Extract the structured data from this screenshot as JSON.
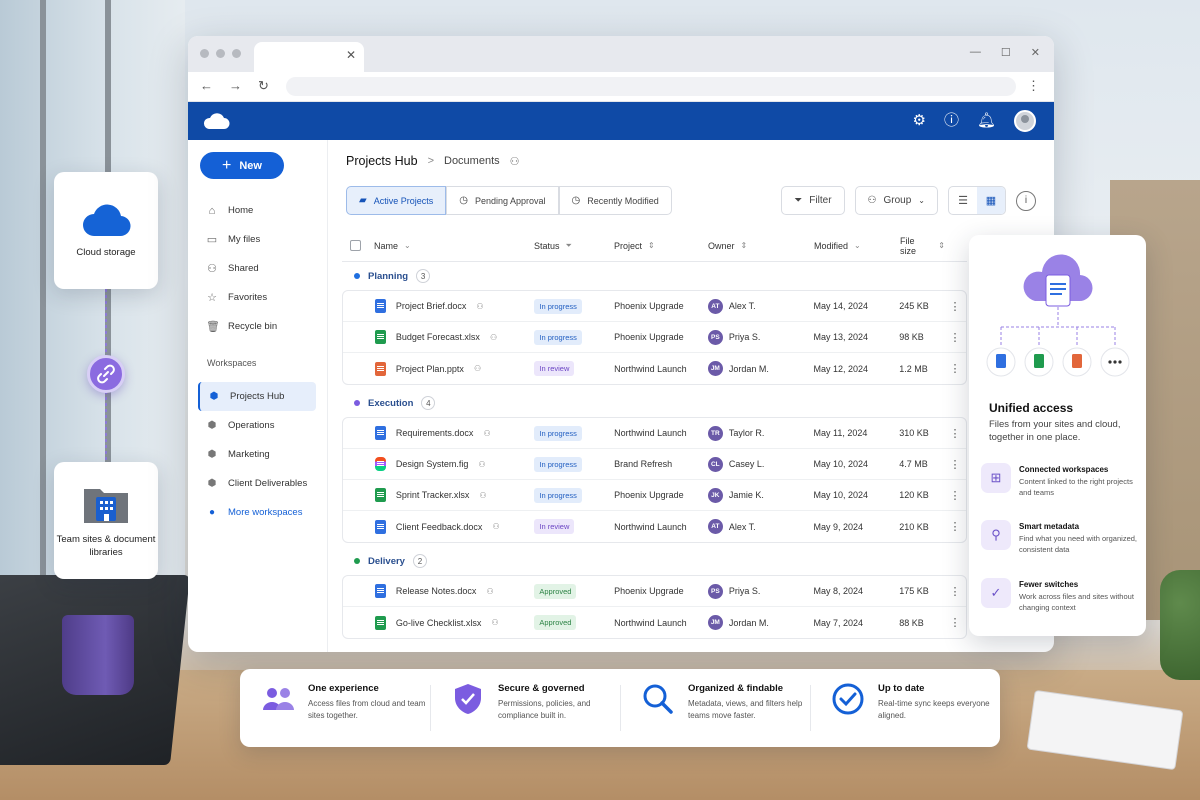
{
  "colors": {
    "brand_blue": "#0f4aa6",
    "accent_blue": "#1460d6",
    "accent_purple": "#7b5ce0",
    "status_progress": "#2460c2",
    "status_review": "#6b45c4",
    "status_approved": "#2d8446"
  },
  "floating": {
    "cloud_label": "Cloud storage",
    "team_label": "Team sites & document libraries"
  },
  "sidebar": {
    "new_label": "New",
    "items": [
      {
        "label": "Home",
        "icon": "home-icon"
      },
      {
        "label": "My files",
        "icon": "folder-icon"
      },
      {
        "label": "Shared",
        "icon": "people-icon"
      },
      {
        "label": "Favorites",
        "icon": "star-icon"
      },
      {
        "label": "Recycle bin",
        "icon": "trash-icon"
      }
    ],
    "workspaces_title": "Workspaces",
    "workspaces": [
      {
        "label": "Projects Hub",
        "active": true
      },
      {
        "label": "Operations"
      },
      {
        "label": "Marketing"
      },
      {
        "label": "Client Deliverables"
      }
    ],
    "more_label": "More workspaces"
  },
  "breadcrumb": {
    "hub": "Projects Hub",
    "separator": ">",
    "current": "Documents"
  },
  "views": {
    "tabs": [
      {
        "label": "Active Projects",
        "icon": "folder-icon",
        "active": true
      },
      {
        "label": "Pending Approval",
        "icon": "clock-icon"
      },
      {
        "label": "Recently Modified",
        "icon": "clock-icon"
      }
    ]
  },
  "toolbar": {
    "filter_label": "Filter",
    "group_label": "Group"
  },
  "table": {
    "columns": {
      "name": "Name",
      "status": "Status",
      "project": "Project",
      "owner": "Owner",
      "modified": "Modified",
      "size": "File size"
    },
    "groups": [
      {
        "name": "Planning",
        "count": "3",
        "color": "#1f6fe0",
        "rows": [
          {
            "file": "Project Brief.docx",
            "type": "doc",
            "status": "In progress",
            "status_kind": "progress",
            "project": "Phoenix Upgrade",
            "initials": "AT",
            "owner": "Alex T.",
            "modified": "May 14, 2024",
            "size": "245 KB"
          },
          {
            "file": "Budget Forecast.xlsx",
            "type": "xls",
            "status": "In progress",
            "status_kind": "progress",
            "project": "Phoenix Upgrade",
            "initials": "PS",
            "owner": "Priya S.",
            "modified": "May 13, 2024",
            "size": "98 KB"
          },
          {
            "file": "Project Plan.pptx",
            "type": "ppt",
            "status": "In review",
            "status_kind": "review",
            "project": "Northwind Launch",
            "initials": "JM",
            "owner": "Jordan M.",
            "modified": "May 12, 2024",
            "size": "1.2 MB"
          }
        ]
      },
      {
        "name": "Execution",
        "count": "4",
        "color": "#7b5ce0",
        "rows": [
          {
            "file": "Requirements.docx",
            "type": "doc",
            "status": "In progress",
            "status_kind": "progress",
            "project": "Northwind Launch",
            "initials": "TR",
            "owner": "Taylor R.",
            "modified": "May 11, 2024",
            "size": "310 KB"
          },
          {
            "file": "Design System.fig",
            "type": "fig",
            "status": "In progress",
            "status_kind": "progress",
            "project": "Brand Refresh",
            "initials": "CL",
            "owner": "Casey L.",
            "modified": "May 10, 2024",
            "size": "4.7 MB"
          },
          {
            "file": "Sprint Tracker.xlsx",
            "type": "xls",
            "status": "In progress",
            "status_kind": "progress",
            "project": "Phoenix Upgrade",
            "initials": "JK",
            "owner": "Jamie K.",
            "modified": "May 10, 2024",
            "size": "120 KB"
          },
          {
            "file": "Client Feedback.docx",
            "type": "doc",
            "status": "In review",
            "status_kind": "review",
            "project": "Northwind Launch",
            "initials": "AT",
            "owner": "Alex T.",
            "modified": "May 9, 2024",
            "size": "210 KB"
          }
        ]
      },
      {
        "name": "Delivery",
        "count": "2",
        "color": "#1f9b4e",
        "rows": [
          {
            "file": "Release Notes.docx",
            "type": "doc",
            "status": "Approved",
            "status_kind": "approved",
            "project": "Phoenix Upgrade",
            "initials": "PS",
            "owner": "Priya S.",
            "modified": "May 8, 2024",
            "size": "175 KB"
          },
          {
            "file": "Go-live Checklist.xlsx",
            "type": "xls",
            "status": "Approved",
            "status_kind": "approved",
            "project": "Northwind Launch",
            "initials": "JM",
            "owner": "Jordan M.",
            "modified": "May 7, 2024",
            "size": "88 KB"
          }
        ]
      }
    ]
  },
  "right_panel": {
    "title": "Unified access",
    "subtitle": "Files from your sites and cloud, together in one place.",
    "features": [
      {
        "title": "Connected workspaces",
        "desc": "Content linked to the right projects and teams",
        "icon": "workspace-icon"
      },
      {
        "title": "Smart metadata",
        "desc": "Find what you need with organized, consistent data",
        "icon": "metadata-icon"
      },
      {
        "title": "Fewer switches",
        "desc": "Work across files and sites without changing context",
        "icon": "check-circle-icon"
      }
    ]
  },
  "banner": [
    {
      "title": "One experience",
      "desc": "Access files from cloud and team sites together.",
      "icon": "people-group-icon"
    },
    {
      "title": "Secure & governed",
      "desc": "Permissions, policies, and compliance built in.",
      "icon": "shield-check-icon"
    },
    {
      "title": "Organized & findable",
      "desc": "Metadata, views, and filters help teams move faster.",
      "icon": "search-icon"
    },
    {
      "title": "Up to date",
      "desc": "Real-time sync keeps everyone aligned.",
      "icon": "check-circle-icon"
    }
  ]
}
